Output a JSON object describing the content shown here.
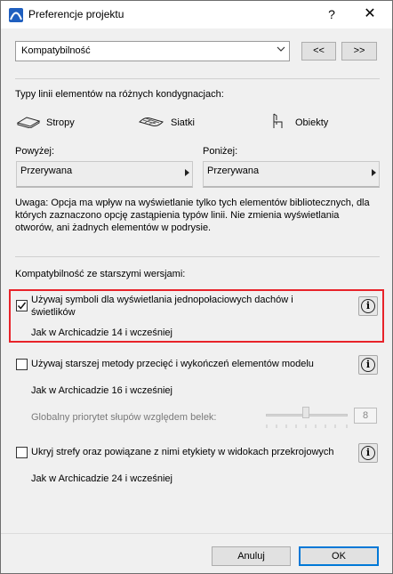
{
  "window": {
    "title": "Preferencje projektu",
    "help_label": "?",
    "close_label": "✕"
  },
  "top": {
    "section_select": "Kompatybilność",
    "prev_label": "<<",
    "next_label": ">>"
  },
  "line_types": {
    "heading": "Typy linii elementów na różnych kondygnacjach:",
    "items": [
      {
        "label": "Stropy",
        "icon": "slab-icon"
      },
      {
        "label": "Siatki",
        "icon": "mesh-icon"
      },
      {
        "label": "Obiekty",
        "icon": "chair-icon"
      }
    ],
    "above_label": "Powyżej:",
    "below_label": "Poniżej:",
    "above_value": "Przerywana",
    "below_value": "Przerywana",
    "note": "Uwaga: Opcja ma wpływ na wyświetlanie tylko tych elementów bibliotecznych, dla których zaznaczono opcję zastąpienia typów linii. Nie zmienia wyświetlania otworów, ani żadnych elementów w podrysie."
  },
  "compat": {
    "heading": "Kompatybilność ze starszymi wersjami:",
    "options": [
      {
        "label_line1": "Używaj symboli dla wyświetlania jednopołaciowych dachów i",
        "label_line2": "świetlików",
        "checked": true,
        "sub": "Jak w Archicadzie 14 i wcześniej"
      },
      {
        "label_line1": "Używaj starszej metody przecięć i wykończeń elementów modelu",
        "label_line2": "",
        "checked": false,
        "sub": "Jak w Archicadzie 16 i wcześniej"
      },
      {
        "label_line1": "Ukryj strefy oraz powiązane z nimi etykiety w widokach przekrojowych",
        "label_line2": "",
        "checked": false,
        "sub": "Jak w Archicadzie 24 i wcześniej"
      }
    ],
    "priority_label": "Globalny priorytet słupów względem belek:",
    "priority_value": "8",
    "info_glyph": "i"
  },
  "footer": {
    "cancel_label": "Anuluj",
    "ok_label": "OK"
  },
  "colors": {
    "highlight": "#e8232a",
    "accent": "#0078d7"
  }
}
